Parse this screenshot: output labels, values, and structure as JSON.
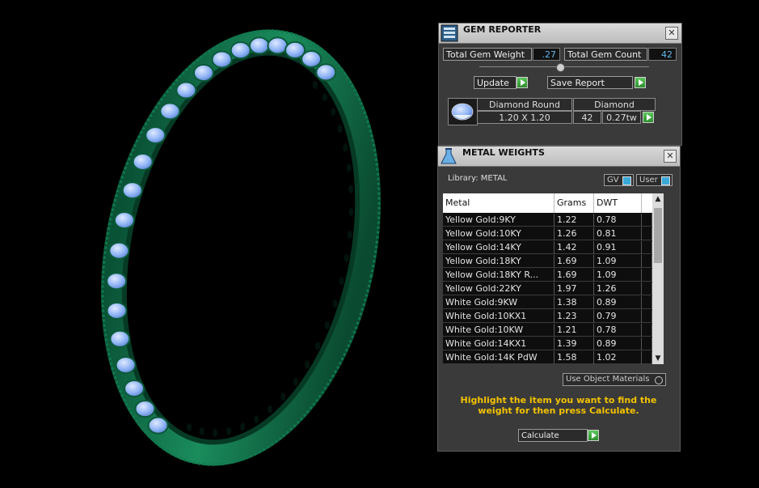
{
  "gem_reporter": {
    "title": "GEM REPORTER",
    "total_gem_weight_label": "Total Gem Weight",
    "total_gem_weight_value": ".27",
    "total_gem_count_label": "Total Gem Count",
    "total_gem_count_value": "42",
    "update_label": "Update",
    "save_report_label": "Save Report",
    "gem": {
      "shape": "Diamond Round",
      "type": "Diamond",
      "size": "1.20 X 1.20",
      "count": "42",
      "weight": "0.27tw"
    }
  },
  "metal_weights": {
    "title": "METAL WEIGHTS",
    "library_label": "Library: METAL",
    "gv_label": "GV",
    "user_label": "User",
    "columns": [
      "Metal",
      "Grams",
      "DWT"
    ],
    "rows": [
      [
        "Yellow Gold:9KY",
        "1.22",
        "0.78"
      ],
      [
        "Yellow Gold:10KY",
        "1.26",
        "0.81"
      ],
      [
        "Yellow Gold:14KY",
        "1.42",
        "0.91"
      ],
      [
        "Yellow Gold:18KY",
        "1.69",
        "1.09"
      ],
      [
        "Yellow Gold:18KY R...",
        "1.69",
        "1.09"
      ],
      [
        "Yellow Gold:22KY",
        "1.97",
        "1.26"
      ],
      [
        "White Gold:9KW",
        "1.38",
        "0.89"
      ],
      [
        "White Gold:10KX1",
        "1.23",
        "0.79"
      ],
      [
        "White Gold:10KW",
        "1.21",
        "0.78"
      ],
      [
        "White Gold:14KX1",
        "1.39",
        "0.89"
      ],
      [
        "White Gold:14K PdW",
        "1.58",
        "1.02"
      ]
    ],
    "use_object_materials_label": "Use Object Materials",
    "instruction": "Highlight the item you want to find the weight for then press Calculate.",
    "calculate_label": "Calculate"
  },
  "colors": {
    "ring": "#0d6a44",
    "gem": "#8fb4f5",
    "accent_value": "#5fb6e8",
    "instruction_text": "#f2c200"
  }
}
